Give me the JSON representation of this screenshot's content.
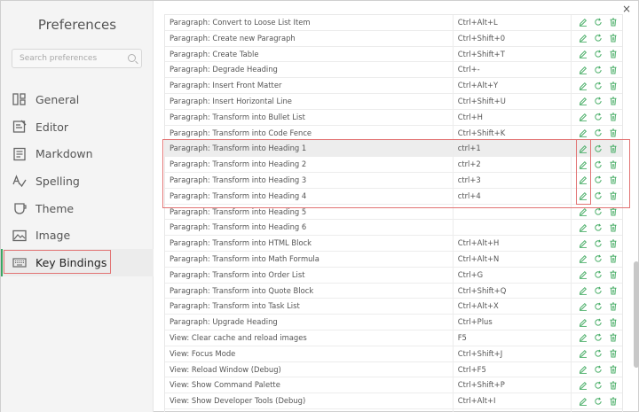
{
  "sidebar": {
    "title": "Preferences",
    "search_placeholder": "Search preferences",
    "items": [
      {
        "label": "General",
        "icon": "general-icon"
      },
      {
        "label": "Editor",
        "icon": "editor-icon"
      },
      {
        "label": "Markdown",
        "icon": "markdown-icon"
      },
      {
        "label": "Spelling",
        "icon": "spelling-icon"
      },
      {
        "label": "Theme",
        "icon": "theme-icon"
      },
      {
        "label": "Image",
        "icon": "image-icon"
      },
      {
        "label": "Key Bindings",
        "icon": "keyboard-icon"
      }
    ],
    "active_item": "Key Bindings"
  },
  "window": {
    "close_label": "×"
  },
  "colors": {
    "accent": "#3aa663",
    "highlight": "#e27474",
    "icon_green": "#4caf6a"
  },
  "keybindings": {
    "rows": [
      {
        "command": "Paragraph: Convert to Loose List Item",
        "shortcut": "Ctrl+Alt+L"
      },
      {
        "command": "Paragraph: Create new Paragraph",
        "shortcut": "Ctrl+Shift+0"
      },
      {
        "command": "Paragraph: Create Table",
        "shortcut": "Ctrl+Shift+T"
      },
      {
        "command": "Paragraph: Degrade Heading",
        "shortcut": "Ctrl+-"
      },
      {
        "command": "Paragraph: Insert Front Matter",
        "shortcut": "Ctrl+Alt+Y"
      },
      {
        "command": "Paragraph: Insert Horizontal Line",
        "shortcut": "Ctrl+Shift+U"
      },
      {
        "command": "Paragraph: Transform into Bullet List",
        "shortcut": "Ctrl+H"
      },
      {
        "command": "Paragraph: Transform into Code Fence",
        "shortcut": "Ctrl+Shift+K"
      },
      {
        "command": "Paragraph: Transform into Heading 1",
        "shortcut": "ctrl+1"
      },
      {
        "command": "Paragraph: Transform into Heading 2",
        "shortcut": "ctrl+2"
      },
      {
        "command": "Paragraph: Transform into Heading 3",
        "shortcut": "ctrl+3"
      },
      {
        "command": "Paragraph: Transform into Heading 4",
        "shortcut": "ctrl+4"
      },
      {
        "command": "Paragraph: Transform into Heading 5",
        "shortcut": ""
      },
      {
        "command": "Paragraph: Transform into Heading 6",
        "shortcut": ""
      },
      {
        "command": "Paragraph: Transform into HTML Block",
        "shortcut": "Ctrl+Alt+H"
      },
      {
        "command": "Paragraph: Transform into Math Formula",
        "shortcut": "Ctrl+Alt+N"
      },
      {
        "command": "Paragraph: Transform into Order List",
        "shortcut": "Ctrl+G"
      },
      {
        "command": "Paragraph: Transform into Quote Block",
        "shortcut": "Ctrl+Shift+Q"
      },
      {
        "command": "Paragraph: Transform into Task List",
        "shortcut": "Ctrl+Alt+X"
      },
      {
        "command": "Paragraph: Upgrade Heading",
        "shortcut": "Ctrl+Plus"
      },
      {
        "command": "View: Clear cache and reload images",
        "shortcut": "F5"
      },
      {
        "command": "View: Focus Mode",
        "shortcut": "Ctrl+Shift+J"
      },
      {
        "command": "View: Reload Window (Debug)",
        "shortcut": "Ctrl+F5"
      },
      {
        "command": "View: Show Command Palette",
        "shortcut": "Ctrl+Shift+P"
      },
      {
        "command": "View: Show Developer Tools (Debug)",
        "shortcut": "Ctrl+Alt+I"
      },
      {
        "command": "",
        "shortcut": ""
      }
    ],
    "selected_row": "Paragraph: Transform into Heading 1",
    "row_actions": [
      "edit-icon",
      "reset-icon",
      "delete-icon"
    ]
  }
}
